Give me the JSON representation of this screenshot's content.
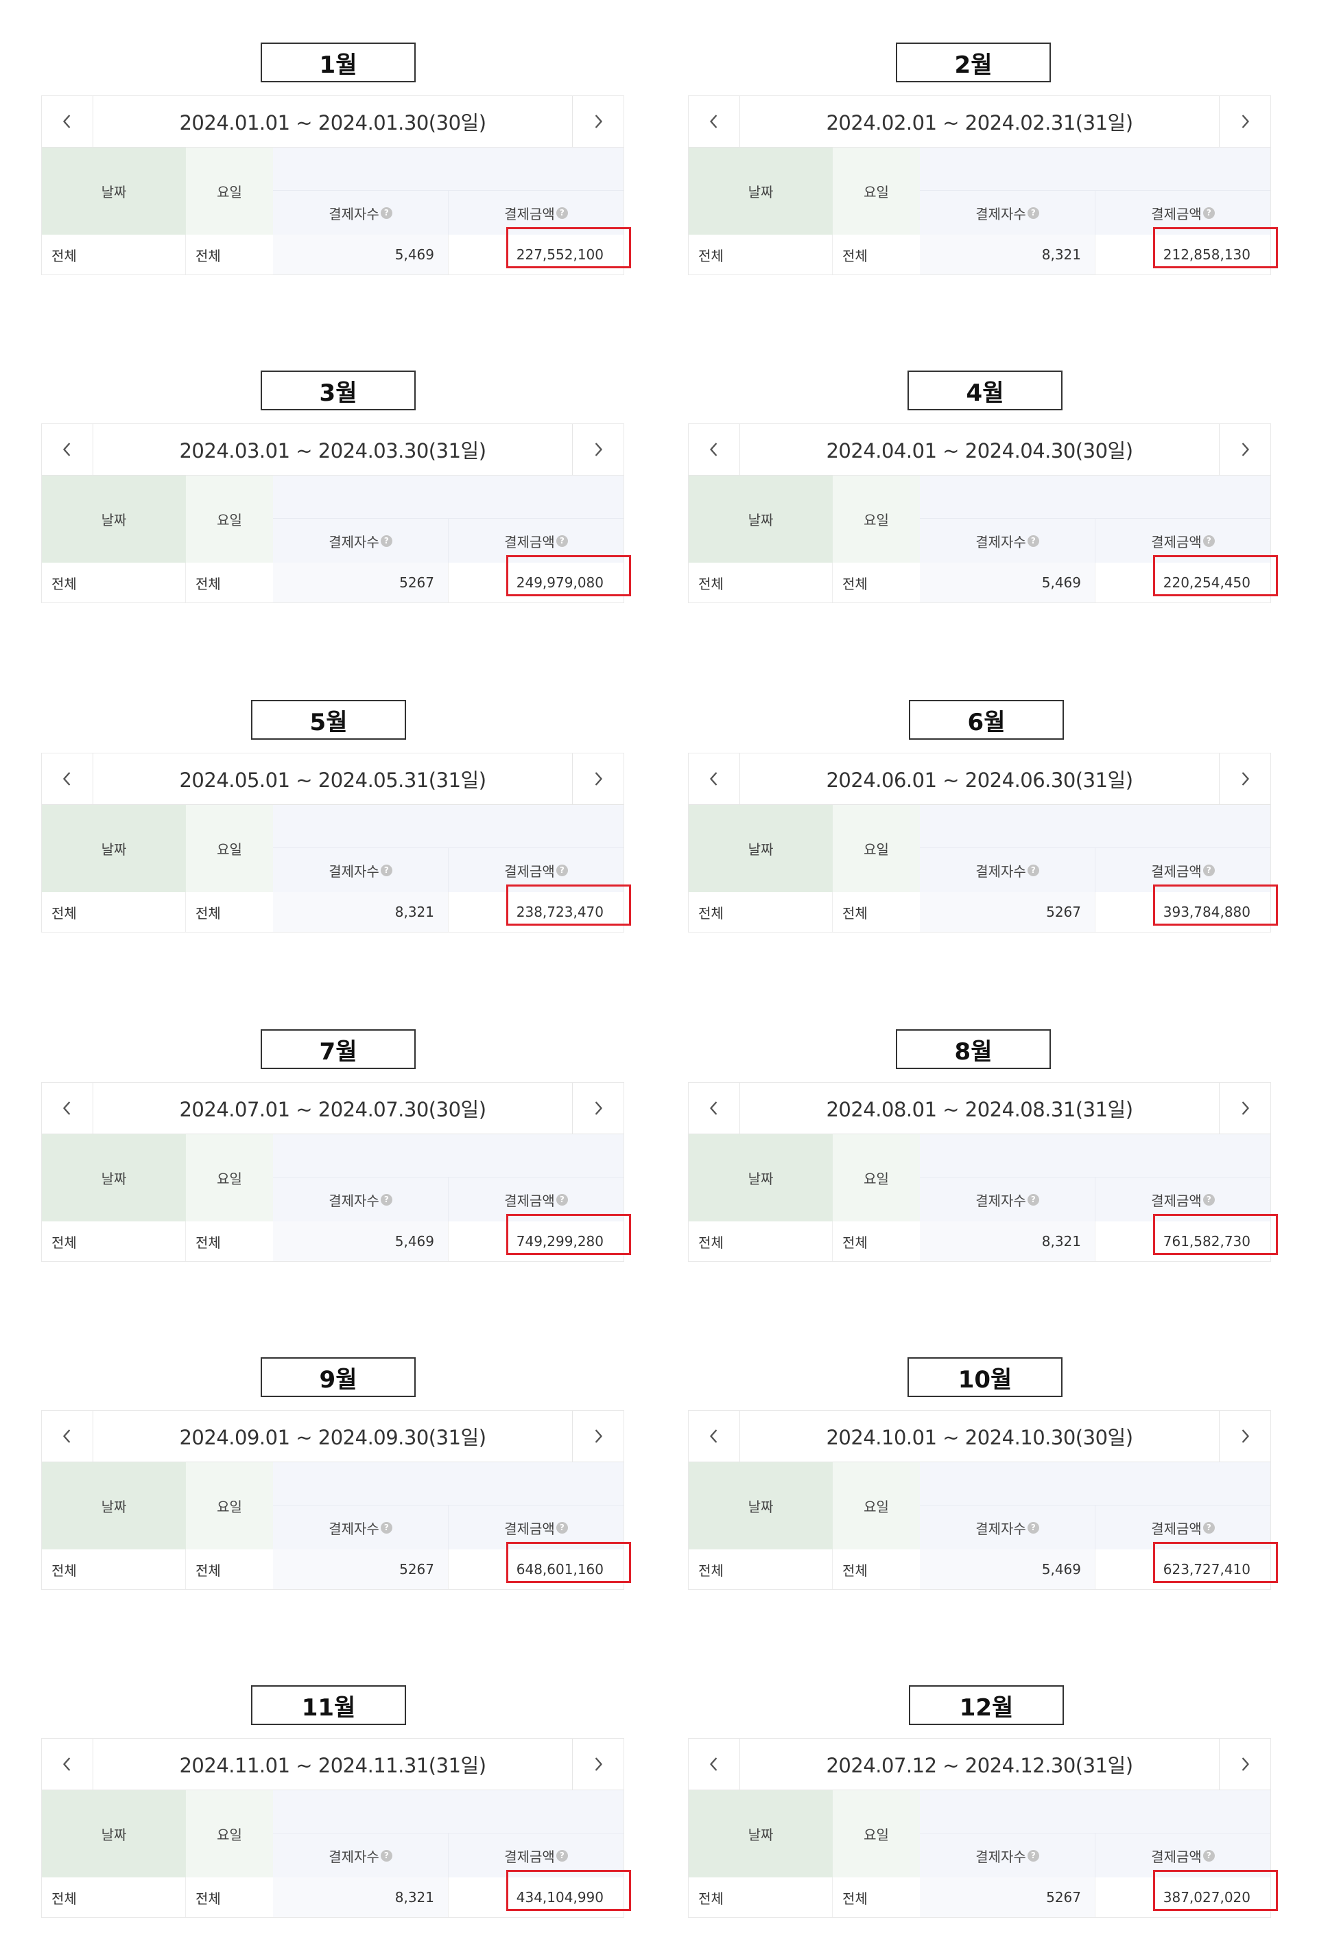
{
  "common": {
    "prev_icon": "chevron-left-icon",
    "next_icon": "chevron-right-icon",
    "help_icon": "question-circle-icon",
    "help_glyph": "?",
    "date_header": "날짜",
    "day_header": "요일",
    "count_header": "결제자수",
    "amount_header": "결제금액",
    "highlight_color": "#e0202a",
    "date_header_bg": "#e3ede3",
    "metrics_header_bg": "#f4f6fb"
  },
  "months": [
    {
      "label": "1월",
      "range": "2024.01.01 ~ 2024.01.30(30일)",
      "date_cell": "전체",
      "day_cell": "전체",
      "count": "5,469",
      "amount": "227,552,100"
    },
    {
      "label": "2월",
      "range": "2024.02.01 ~ 2024.02.31(31일)",
      "date_cell": "전체",
      "day_cell": "전체",
      "count": "8,321",
      "amount": "212,858,130"
    },
    {
      "label": "3월",
      "range": "2024.03.01 ~ 2024.03.30(31일)",
      "date_cell": "전체",
      "day_cell": "전체",
      "count": "5267",
      "amount": "249,979,080"
    },
    {
      "label": "4월",
      "range": "2024.04.01 ~ 2024.04.30(30일)",
      "date_cell": "전체",
      "day_cell": "전체",
      "count": "5,469",
      "amount": "220,254,450"
    },
    {
      "label": "5월",
      "range": "2024.05.01 ~ 2024.05.31(31일)",
      "date_cell": "전체",
      "day_cell": "전체",
      "count": "8,321",
      "amount": "238,723,470"
    },
    {
      "label": "6월",
      "range": "2024.06.01 ~ 2024.06.30(31일)",
      "date_cell": "전체",
      "day_cell": "전체",
      "count": "5267",
      "amount": "393,784,880"
    },
    {
      "label": "7월",
      "range": "2024.07.01 ~ 2024.07.30(30일)",
      "date_cell": "전체",
      "day_cell": "전체",
      "count": "5,469",
      "amount": "749,299,280"
    },
    {
      "label": "8월",
      "range": "2024.08.01 ~ 2024.08.31(31일)",
      "date_cell": "전체",
      "day_cell": "전체",
      "count": "8,321",
      "amount": "761,582,730"
    },
    {
      "label": "9월",
      "range": "2024.09.01 ~ 2024.09.30(31일)",
      "date_cell": "전체",
      "day_cell": "전체",
      "count": "5267",
      "amount": "648,601,160"
    },
    {
      "label": "10월",
      "range": "2024.10.01 ~ 2024.10.30(30일)",
      "date_cell": "전체",
      "day_cell": "전체",
      "count": "5,469",
      "amount": "623,727,410"
    },
    {
      "label": "11월",
      "range": "2024.11.01 ~ 2024.11.31(31일)",
      "date_cell": "전체",
      "day_cell": "전체",
      "count": "8,321",
      "amount": "434,104,990"
    },
    {
      "label": "12월",
      "range": "2024.07.12 ~ 2024.12.30(31일)",
      "date_cell": "전체",
      "day_cell": "전체",
      "count": "5267",
      "amount": "387,027,020"
    }
  ]
}
